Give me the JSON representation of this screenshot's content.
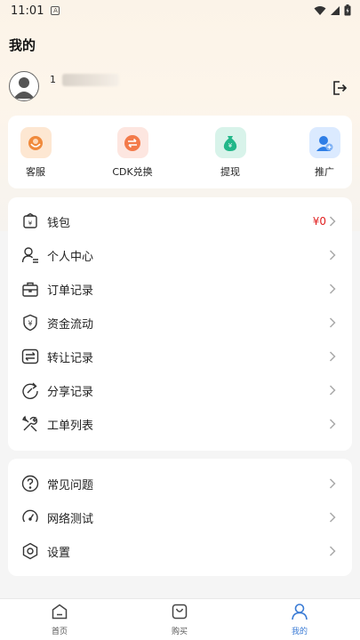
{
  "status": {
    "time": "11:01",
    "notif_badge": "A"
  },
  "page": {
    "title": "我的"
  },
  "profile": {
    "username": "1"
  },
  "quick_actions": [
    {
      "label": "客服",
      "icon": "headset-icon",
      "bg": "#fde7d2",
      "color": "#f08a3c"
    },
    {
      "label": "CDK兑换",
      "icon": "exchange-icon",
      "bg": "#fde6e0",
      "color": "#f37a4a"
    },
    {
      "label": "提现",
      "icon": "money-bag-icon",
      "bg": "#d8f3ea",
      "color": "#22b789"
    },
    {
      "label": "推广",
      "icon": "promote-user-icon",
      "bg": "#dbeaff",
      "color": "#2f7ee6"
    }
  ],
  "menu": [
    {
      "label": "钱包",
      "value": "¥0",
      "icon": "wallet-icon"
    },
    {
      "label": "个人中心",
      "icon": "user-center-icon"
    },
    {
      "label": "订单记录",
      "icon": "order-bag-icon"
    },
    {
      "label": "资金流动",
      "icon": "shield-yuan-icon"
    },
    {
      "label": "转让记录",
      "icon": "transfer-icon"
    },
    {
      "label": "分享记录",
      "icon": "share-refresh-icon"
    },
    {
      "label": "工单列表",
      "icon": "tools-icon"
    }
  ],
  "menu2": [
    {
      "label": "常见问题",
      "icon": "question-icon"
    },
    {
      "label": "网络测试",
      "icon": "speed-gauge-icon"
    },
    {
      "label": "设置",
      "icon": "settings-icon"
    }
  ],
  "tabs": [
    {
      "label": "首页",
      "icon": "home-icon"
    },
    {
      "label": "购买",
      "icon": "shopping-bag-icon"
    },
    {
      "label": "我的",
      "icon": "profile-icon",
      "active": true
    }
  ],
  "colors": {
    "accent": "#3a7bd5",
    "price": "#e02020"
  }
}
